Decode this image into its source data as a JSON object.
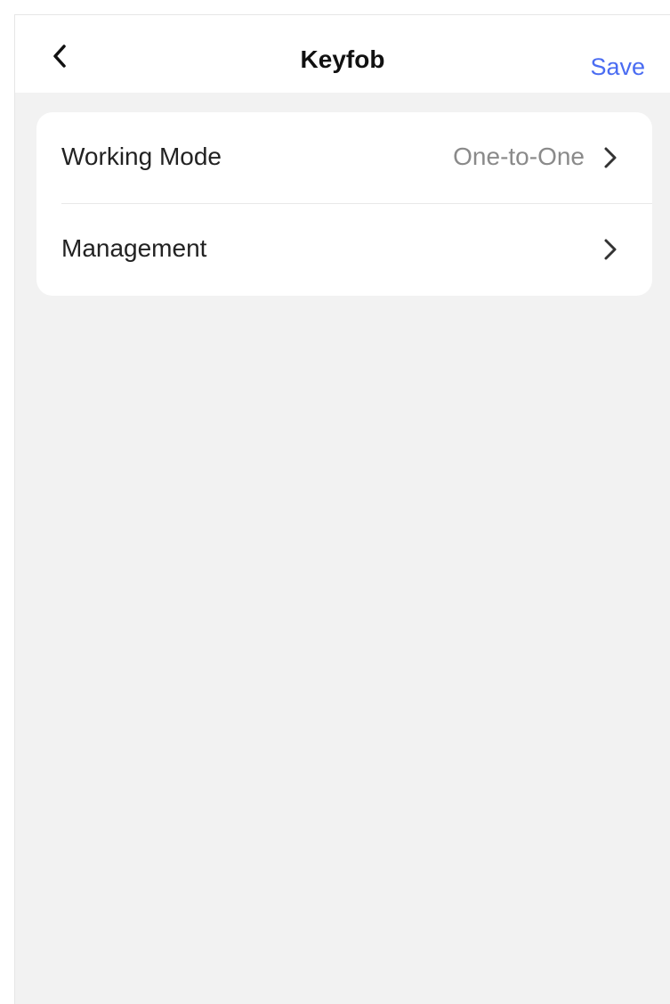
{
  "header": {
    "title": "Keyfob",
    "save_label": "Save",
    "back_icon": "chevron-left-icon"
  },
  "settings": {
    "items": [
      {
        "label": "Working Mode",
        "value": "One-to-One",
        "icon": "chevron-right-icon"
      },
      {
        "label": "Management",
        "value": "",
        "icon": "chevron-right-icon"
      }
    ]
  },
  "colors": {
    "accent": "#4a6cf2",
    "background": "#f2f2f2",
    "card": "#ffffff",
    "secondary_text": "#8a8a8a"
  }
}
